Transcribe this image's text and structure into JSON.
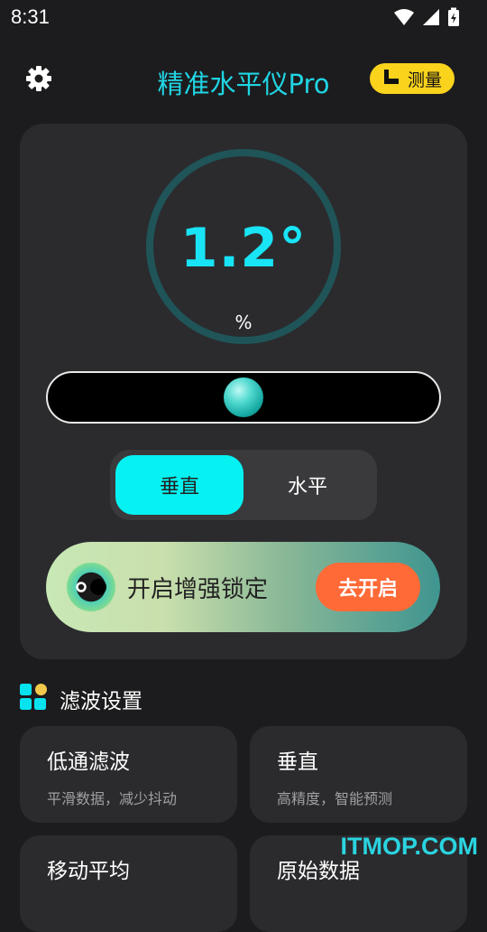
{
  "status_bar": {
    "time": "8:31",
    "icons": [
      "wifi-icon",
      "signal-icon",
      "battery-charging-icon"
    ]
  },
  "header": {
    "title": "精准水平仪Pro",
    "measure_label": "测量",
    "settings_icon": "gear-icon",
    "measure_icon": "ruler-icon"
  },
  "gauge": {
    "value": "1.2°",
    "unit": "%"
  },
  "level": {
    "bubble_position_fraction": 0.5
  },
  "mode_toggle": {
    "options": [
      "垂直",
      "水平"
    ],
    "selected": "垂直"
  },
  "promo": {
    "text": "开启增强锁定",
    "button_label": "去开启"
  },
  "filter_section": {
    "title": "滤波设置",
    "items": [
      {
        "title": "低通滤波",
        "desc": "平滑数据，减少抖动"
      },
      {
        "title": "垂直",
        "desc": "高精度，智能预测"
      },
      {
        "title": "移动平均",
        "desc": ""
      },
      {
        "title": "原始数据",
        "desc": ""
      }
    ]
  },
  "watermark": "ITMOP.COM",
  "colors": {
    "accent": "#20d5e4",
    "gauge_value": "#18e4f5",
    "measure_bg": "#f9d31c",
    "promo_button": "#ff6a37",
    "toggle_active": "#06f2f2"
  }
}
